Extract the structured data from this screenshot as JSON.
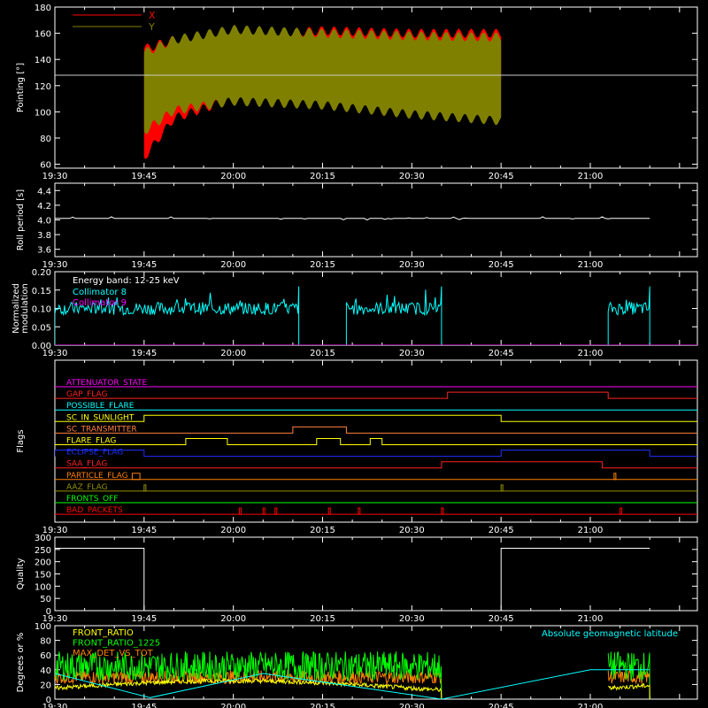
{
  "time_axis": {
    "ticks": [
      "19:30",
      "19:45",
      "20:00",
      "20:15",
      "20:30",
      "20:45",
      "21:00"
    ]
  },
  "colors": {
    "background": "#000000",
    "axes": "#ffffff",
    "x": "#ff0000",
    "y": "#808000",
    "cyan": "#00ffff",
    "magenta": "#ff00ff",
    "green": "#00ff00",
    "yellow": "#ffff00"
  },
  "chart_data": [
    {
      "type": "area",
      "ylabel": "Pointing [°]",
      "ylim": [
        57,
        180
      ],
      "yticks": [
        60,
        80,
        100,
        120,
        140,
        160,
        180
      ],
      "reference_line": 128,
      "legend": {
        "placement": "top-left",
        "entries": [
          {
            "name": "X",
            "color": "#ff0000"
          },
          {
            "name": "Y",
            "color": "#808000"
          }
        ]
      },
      "series": [
        {
          "name": "X",
          "x": [
            "19:45",
            "19:50",
            "20:00",
            "20:15",
            "20:30",
            "20:45"
          ],
          "low": [
            65,
            95,
            110,
            113,
            120,
            122
          ],
          "high": [
            148,
            155,
            158,
            162,
            160,
            160
          ]
        },
        {
          "name": "Y",
          "x": [
            "19:45",
            "19:50",
            "20:00",
            "20:15",
            "20:30",
            "20:45"
          ],
          "low": [
            85,
            101,
            108,
            105,
            98,
            93
          ],
          "high": [
            145,
            155,
            163,
            160,
            158,
            157
          ]
        }
      ]
    },
    {
      "type": "line",
      "ylabel": "Roll period [s]",
      "ylim": [
        3.5,
        4.5
      ],
      "yticks": [
        "3.6",
        "3.8",
        "4.0",
        "4.2",
        "4.4"
      ],
      "series": [
        {
          "x": [
            "19:30",
            "21:10"
          ],
          "values": [
            4.02,
            4.02
          ]
        }
      ]
    },
    {
      "type": "line",
      "ylabel": "Normalized modulation",
      "ylim": [
        0,
        0.2
      ],
      "yticks": [
        "0.00",
        "0.05",
        "0.10",
        "0.15",
        "0.20"
      ],
      "annotation": "Energy band: 12-25 keV",
      "legend": {
        "placement": "top-left",
        "entries": [
          {
            "name": "Collimator 8",
            "color": "#00ffff"
          },
          {
            "name": "Collimator 9",
            "color": "#ff00ff"
          }
        ]
      },
      "segments": [
        {
          "series": "Collimator 8",
          "x_start": "19:30",
          "x_end": "20:11",
          "mean": 0.1
        },
        {
          "series": "Collimator 8",
          "x_start": "20:19",
          "x_end": "20:35",
          "mean": 0.1
        },
        {
          "series": "Collimator 8",
          "x_start": "21:03",
          "x_end": "21:10",
          "mean": 0.1
        },
        {
          "series": "Collimator 9",
          "x_start": "19:30",
          "x_end": "21:10",
          "mean": 0.0
        }
      ]
    },
    {
      "type": "line",
      "ylabel": "Flags",
      "series": [
        {
          "name": "ATTENUATOR_STATE",
          "color": "#ff00ff",
          "on": []
        },
        {
          "name": "GAP_FLAG",
          "color": "#ff2020",
          "on": [
            [
              "20:36",
              "21:03"
            ]
          ]
        },
        {
          "name": "POSSIBLE_FLARE",
          "color": "#00ffff",
          "on": []
        },
        {
          "name": "SC_IN_SUNLIGHT",
          "color": "#ffff00",
          "on": [
            [
              "19:45",
              "20:45"
            ]
          ]
        },
        {
          "name": "SC_TRANSMITTER",
          "color": "#ff8040",
          "on": [
            [
              "20:10",
              "20:19"
            ]
          ]
        },
        {
          "name": "FLARE_FLAG",
          "color": "#ffff00",
          "on": [
            [
              "19:52",
              "19:59"
            ],
            [
              "20:14",
              "20:18"
            ],
            [
              "20:23",
              "20:25"
            ]
          ]
        },
        {
          "name": "ECLIPSE_FLAG",
          "color": "#2030ff",
          "on": [
            [
              "19:30",
              "19:45"
            ],
            [
              "20:45",
              "21:10"
            ]
          ]
        },
        {
          "name": "SAA_FLAG",
          "color": "#ff2020",
          "on": [
            [
              "20:35",
              "21:02"
            ]
          ]
        },
        {
          "name": "PARTICLE_FLAG",
          "color": "#ff8000",
          "on": [
            [
              "19:43",
              "19:44"
            ],
            [
              "21:04",
              "21:04"
            ]
          ]
        },
        {
          "name": "AAZ_FLAG",
          "color": "#909000",
          "on": [
            [
              "19:45",
              "19:45"
            ],
            [
              "20:45",
              "20:45"
            ]
          ]
        },
        {
          "name": "FRONTS_OFF",
          "color": "#00ff00",
          "on": []
        },
        {
          "name": "BAD_PACKETS",
          "color": "#ff0000",
          "on": [
            [
              "20:01",
              "20:01"
            ],
            [
              "20:05",
              "20:05"
            ],
            [
              "20:07",
              "20:07"
            ],
            [
              "20:16",
              "20:16"
            ],
            [
              "20:21",
              "20:21"
            ],
            [
              "20:35",
              "20:35"
            ],
            [
              "21:05",
              "21:05"
            ]
          ]
        }
      ]
    },
    {
      "type": "line",
      "ylabel": "Quality",
      "ylim": [
        0,
        300
      ],
      "yticks": [
        "0",
        "50",
        "100",
        "150",
        "200",
        "250",
        "300"
      ],
      "series": [
        {
          "x": [
            "19:30",
            "19:45",
            "19:45",
            "20:45",
            "20:45",
            "21:10"
          ],
          "values": [
            255,
            255,
            0,
            0,
            255,
            255
          ]
        }
      ]
    },
    {
      "type": "line",
      "ylabel": "Degrees or %",
      "ylim": [
        0,
        100
      ],
      "yticks": [
        "0",
        "20",
        "40",
        "60",
        "80",
        "100"
      ],
      "legend": {
        "placement": "top-left",
        "entries": [
          {
            "name": "FRONT_RATIO",
            "color": "#ffff00"
          },
          {
            "name": "FRONT_RATIO_1225",
            "color": "#00ff00"
          },
          {
            "name": "MAX_DET_VS_TOT",
            "color": "#ff8000"
          }
        ]
      },
      "annotation_right": "Absolute geomagnetic latitude",
      "series": [
        {
          "name": "FRONT_RATIO",
          "segments": [
            [
              "19:30",
              "20:35",
              15
            ],
            [
              "21:03",
              "21:10",
              15
            ]
          ]
        },
        {
          "name": "FRONT_RATIO_1225",
          "segments": [
            [
              "19:30",
              "20:35",
              45
            ],
            [
              "21:03",
              "21:10",
              45
            ]
          ]
        },
        {
          "name": "MAX_DET_VS_TOT",
          "segments": [
            [
              "19:30",
              "20:35",
              30
            ],
            [
              "21:03",
              "21:10",
              30
            ]
          ]
        },
        {
          "name": "Absolute geomagnetic latitude",
          "x": [
            "19:30",
            "19:46",
            "20:05",
            "20:35",
            "21:00",
            "21:10"
          ],
          "values": [
            35,
            2,
            35,
            0,
            40,
            40
          ]
        }
      ]
    }
  ]
}
